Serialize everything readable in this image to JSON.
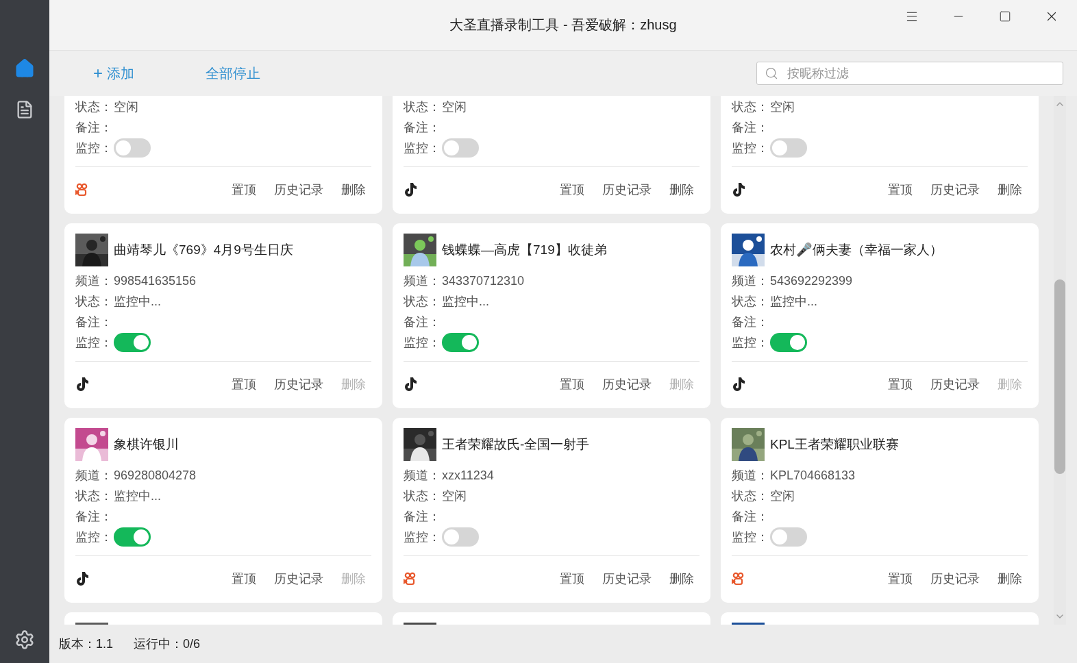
{
  "window": {
    "title": "大圣直播录制工具 - 吾爱破解：zhusg"
  },
  "sidebar": {
    "items": [
      {
        "selected": true
      },
      {
        "selected": false
      }
    ]
  },
  "toolbar": {
    "add": {
      "icon": "+",
      "label": "添加"
    },
    "stop_all": {
      "label": "全部停止"
    },
    "search": {
      "placeholder": "按昵称过滤"
    }
  },
  "cards": [
    {
      "fields": [
        {
          "label": "状态：",
          "value": "空闲"
        },
        {
          "label": "备注："
        }
      ],
      "monitor": {
        "label": "监控：",
        "on": false
      },
      "platform": {
        "kind": "kuaishou"
      },
      "actions": [
        {
          "label": "置顶",
          "disabled": false
        },
        {
          "label": "历史记录",
          "disabled": false
        },
        {
          "label": "删除",
          "disabled": false
        }
      ]
    },
    {
      "fields": [
        {
          "label": "状态：",
          "value": "空闲"
        },
        {
          "label": "备注："
        }
      ],
      "monitor": {
        "label": "监控：",
        "on": false
      },
      "platform": {
        "kind": "douyin"
      },
      "actions": [
        {
          "label": "置顶",
          "disabled": false
        },
        {
          "label": "历史记录",
          "disabled": false
        },
        {
          "label": "删除",
          "disabled": false
        }
      ]
    },
    {
      "fields": [
        {
          "label": "状态：",
          "value": "空闲"
        },
        {
          "label": "备注："
        }
      ],
      "monitor": {
        "label": "监控：",
        "on": false
      },
      "platform": {
        "kind": "douyin"
      },
      "actions": [
        {
          "label": "置顶",
          "disabled": false
        },
        {
          "label": "历史记录",
          "disabled": false
        },
        {
          "label": "删除",
          "disabled": false
        }
      ]
    },
    {
      "avatar": {
        "kind": "picture"
      },
      "name": "曲靖琴儿《769》4月9号生日庆",
      "fields": [
        {
          "label": "频道：",
          "value": "998541635156"
        },
        {
          "label": "状态：",
          "value": "监控中..."
        },
        {
          "label": "备注："
        }
      ],
      "monitor": {
        "label": "监控：",
        "on": true
      },
      "platform": {
        "kind": "douyin"
      },
      "actions": [
        {
          "label": "置顶",
          "disabled": false
        },
        {
          "label": "历史记录",
          "disabled": false
        },
        {
          "label": "删除",
          "disabled": true
        }
      ]
    },
    {
      "avatar": {
        "kind": "picture"
      },
      "name": "钱蝶蝶—高虎【719】收徒弟",
      "fields": [
        {
          "label": "频道：",
          "value": "343370712310"
        },
        {
          "label": "状态：",
          "value": "监控中..."
        },
        {
          "label": "备注："
        }
      ],
      "monitor": {
        "label": "监控：",
        "on": true
      },
      "platform": {
        "kind": "douyin"
      },
      "actions": [
        {
          "label": "置顶",
          "disabled": false
        },
        {
          "label": "历史记录",
          "disabled": false
        },
        {
          "label": "删除",
          "disabled": true
        }
      ]
    },
    {
      "avatar": {
        "kind": "picture"
      },
      "name": "农村🎤俩夫妻（幸福一家人）",
      "fields": [
        {
          "label": "频道：",
          "value": "543692292399"
        },
        {
          "label": "状态：",
          "value": "监控中..."
        },
        {
          "label": "备注："
        }
      ],
      "monitor": {
        "label": "监控：",
        "on": true
      },
      "platform": {
        "kind": "douyin"
      },
      "actions": [
        {
          "label": "置顶",
          "disabled": false
        },
        {
          "label": "历史记录",
          "disabled": false
        },
        {
          "label": "删除",
          "disabled": true
        }
      ]
    },
    {
      "avatar": {
        "kind": "picture"
      },
      "name": "象棋许银川",
      "fields": [
        {
          "label": "频道：",
          "value": "969280804278"
        },
        {
          "label": "状态：",
          "value": "监控中..."
        },
        {
          "label": "备注："
        }
      ],
      "monitor": {
        "label": "监控：",
        "on": true
      },
      "platform": {
        "kind": "douyin"
      },
      "actions": [
        {
          "label": "置顶",
          "disabled": false
        },
        {
          "label": "历史记录",
          "disabled": false
        },
        {
          "label": "删除",
          "disabled": true
        }
      ]
    },
    {
      "avatar": {
        "kind": "picture"
      },
      "name": "王者荣耀故氏-全国一射手",
      "fields": [
        {
          "label": "频道：",
          "value": "xzx11234"
        },
        {
          "label": "状态：",
          "value": "空闲"
        },
        {
          "label": "备注："
        }
      ],
      "monitor": {
        "label": "监控：",
        "on": false
      },
      "platform": {
        "kind": "kuaishou"
      },
      "actions": [
        {
          "label": "置顶",
          "disabled": false
        },
        {
          "label": "历史记录",
          "disabled": false
        },
        {
          "label": "删除",
          "disabled": false
        }
      ]
    },
    {
      "avatar": {
        "kind": "picture"
      },
      "name": "KPL王者荣耀职业联赛",
      "fields": [
        {
          "label": "频道：",
          "value": "KPL704668133"
        },
        {
          "label": "状态：",
          "value": "空闲"
        },
        {
          "label": "备注："
        }
      ],
      "monitor": {
        "label": "监控：",
        "on": false
      },
      "platform": {
        "kind": "kuaishou"
      },
      "actions": [
        {
          "label": "置顶",
          "disabled": false
        },
        {
          "label": "历史记录",
          "disabled": false
        },
        {
          "label": "删除",
          "disabled": false
        }
      ]
    },
    {
      "avatar": {
        "kind": "picture"
      }
    },
    {
      "avatar": {
        "kind": "picture"
      }
    },
    {
      "avatar": {
        "kind": "picture"
      }
    }
  ],
  "status_bar": {
    "version": "版本：1.1",
    "running": "运行中：0/6"
  }
}
